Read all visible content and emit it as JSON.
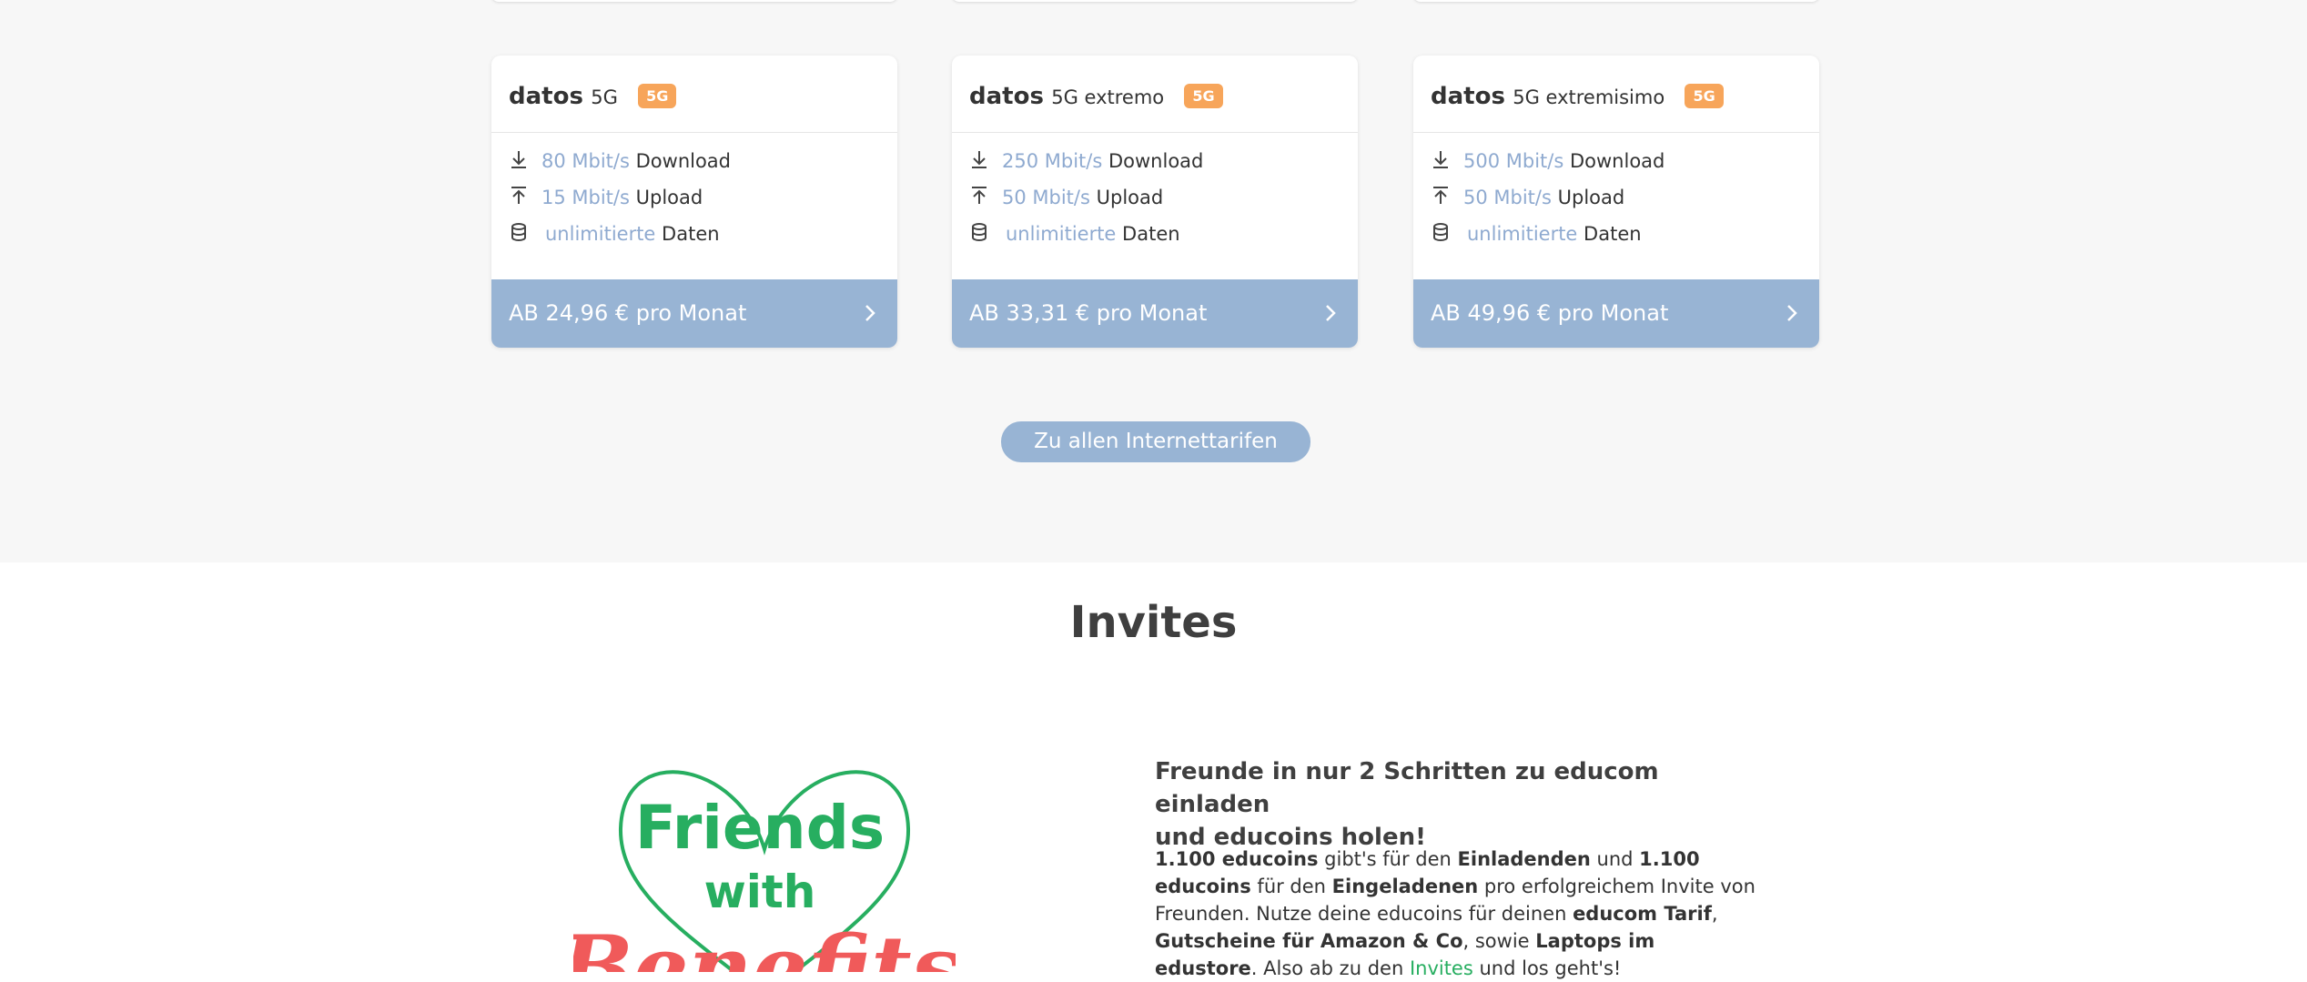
{
  "cards": [
    {
      "name": "datos",
      "sub": "5G",
      "badge": "5G",
      "download_value": "80 Mbit/s",
      "download_label": "Download",
      "upload_value": "15 Mbit/s",
      "upload_label": "Upload",
      "data_value": "unlimitierte",
      "data_label": "Daten",
      "price": "AB 24,96 € pro Monat"
    },
    {
      "name": "datos",
      "sub": "5G extremo",
      "badge": "5G",
      "download_value": "250 Mbit/s",
      "download_label": "Download",
      "upload_value": "50 Mbit/s",
      "upload_label": "Upload",
      "data_value": "unlimitierte",
      "data_label": "Daten",
      "price": "AB 33,31 € pro Monat"
    },
    {
      "name": "datos",
      "sub": "5G extremisimo",
      "badge": "5G",
      "download_value": "500 Mbit/s",
      "download_label": "Download",
      "upload_value": "50 Mbit/s",
      "upload_label": "Upload",
      "data_value": "unlimitierte",
      "data_label": "Daten",
      "price": "AB 49,96 € pro Monat"
    }
  ],
  "all_tariffs_button": "Zu allen Internettarifen",
  "invites": {
    "title": "Invites",
    "logo_words": [
      "Friends",
      "with",
      "Benefits"
    ],
    "lead_line1": "Freunde in nur 2 Schritten zu educom einladen",
    "lead_line2": "und educoins holen!",
    "p1": "1.100 educoins",
    "p2": " gibt's für den ",
    "p3": "Einladenden",
    "p4": " und ",
    "p5": "1.100 educoins",
    "p6": " für den ",
    "p7": "Eingeladenen",
    "p8": " pro erfolgreichem Invite von Freunden. Nutze deine educoins für deinen ",
    "p9": "educom Tarif",
    "p10": ", ",
    "p11": "Gutscheine für Amazon & Co",
    "p12": ", sowie ",
    "p13": "Laptops im edustore",
    "p14": ". Also ab zu den ",
    "p15": "Invites",
    "p16": " und los geht's!"
  },
  "colors": {
    "accent_blue": "#98b4d4",
    "value_blue": "#8faad0",
    "badge_orange": "#f7a55a",
    "heart_green": "#27ae60",
    "script_red": "#f05a5a"
  },
  "icons": [
    "download-icon",
    "upload-icon",
    "database-icon",
    "chevron-right-icon"
  ]
}
